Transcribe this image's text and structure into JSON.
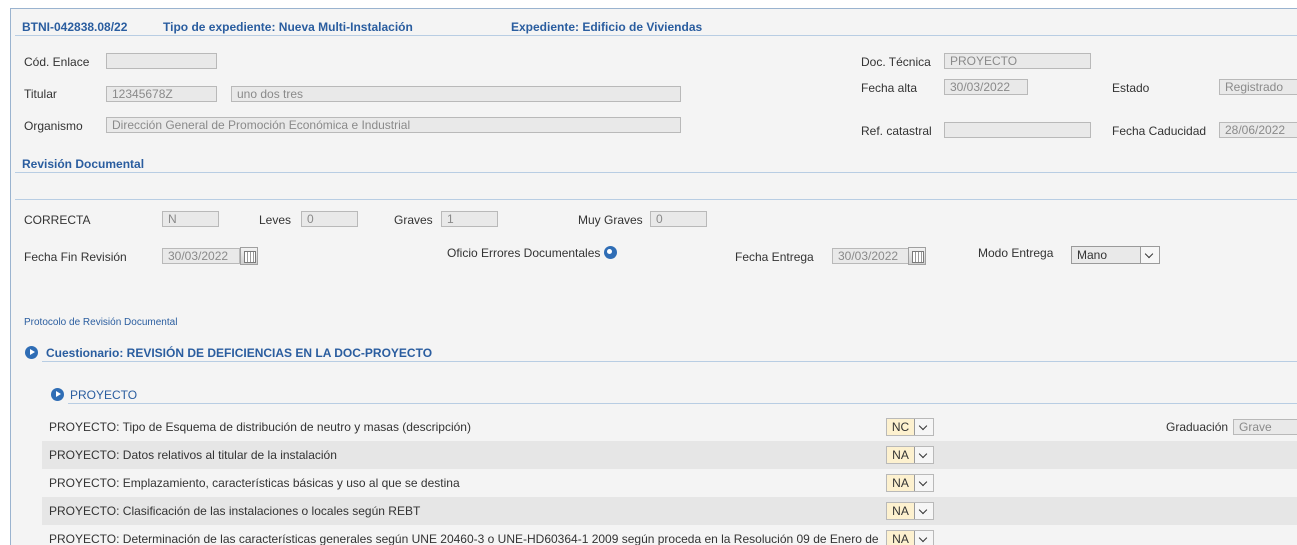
{
  "header": {
    "expediente_id": "BTNI-042838.08/22",
    "tipo": "Tipo de expediente: Nueva Multi-Instalación",
    "expediente": "Expediente: Edificio de Viviendas"
  },
  "general": {
    "cod_enlace_label": "Cód. Enlace",
    "cod_enlace_value": "",
    "titular_label": "Titular",
    "titular_nif": "12345678Z",
    "titular_nombre": "uno dos tres",
    "organismo_label": "Organismo",
    "organismo_value": "Dirección General de Promoción Económica e Industrial",
    "doc_tecnica_label": "Doc. Técnica",
    "doc_tecnica_value": "PROYECTO",
    "fecha_alta_label": "Fecha alta",
    "fecha_alta_value": "30/03/2022",
    "estado_label": "Estado",
    "estado_value": "Registrado",
    "ref_catastral_label": "Ref. catastral",
    "ref_catastral_value": "",
    "fecha_caducidad_label": "Fecha Caducidad",
    "fecha_caducidad_value": "28/06/2022"
  },
  "revision": {
    "title": "Revisión Documental",
    "correcta_label": "CORRECTA",
    "correcta_value": "N",
    "leves_label": "Leves",
    "leves_value": "0",
    "graves_label": "Graves",
    "graves_value": "1",
    "muy_graves_label": "Muy Graves",
    "muy_graves_value": "0",
    "fecha_fin_label": "Fecha Fin Revisión",
    "fecha_fin_value": "30/03/2022",
    "oficio_label": "Oficio Errores Documentales",
    "fecha_entrega_label": "Fecha Entrega",
    "fecha_entrega_value": "30/03/2022",
    "modo_entrega_label": "Modo Entrega",
    "modo_entrega_value": "Mano",
    "protocolo_link": "Protocolo de Revisión Documental"
  },
  "cuestionario": {
    "title": "Cuestionario: REVISIÓN DE DEFICIENCIAS EN LA DOC-PROYECTO",
    "group_title": "PROYECTO",
    "graduacion_label": "Graduación",
    "graduacion_value": "Grave",
    "questions": [
      {
        "text": "PROYECTO: Tipo de Esquema de distribución de neutro y masas (descripción)",
        "value": "NC"
      },
      {
        "text": "PROYECTO: Datos relativos al titular de la instalación",
        "value": "NA"
      },
      {
        "text": "PROYECTO: Emplazamiento, características básicas y uso al que se destina",
        "value": "NA"
      },
      {
        "text": "PROYECTO: Clasificación de las instalaciones o locales según REBT",
        "value": "NA"
      },
      {
        "text": "PROYECTO: Determinación de las características generales según UNE 20460-3 o UNE-HD60364-1 2009 según proceda en la Resolución 09 de Enero de",
        "value": "NA"
      }
    ]
  },
  "colors": {
    "accent": "#2a5d9f",
    "background": "#f4f4f4",
    "field_bg": "#e9e9e9",
    "select_highlight": "#fdf1cf"
  }
}
